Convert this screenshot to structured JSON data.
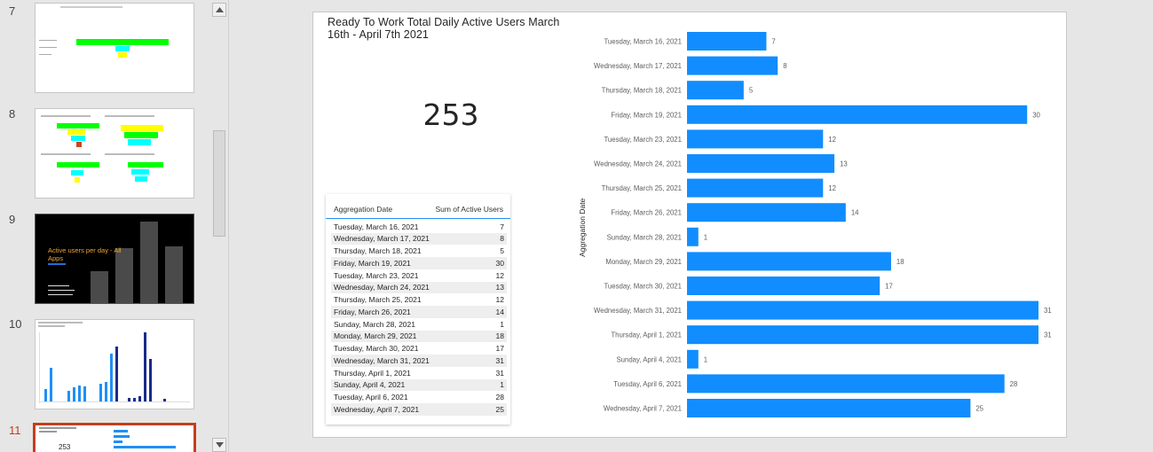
{
  "slides": {
    "numbers": [
      "7",
      "8",
      "9",
      "10",
      "11"
    ],
    "thumb9_text": "Active users per day - All Apps",
    "thumb11_kpi": "253"
  },
  "main": {
    "title": "Ready To Work Total Daily Active Users March 16th - April 7th 2021",
    "kpi_value": "253",
    "table": {
      "col_date": "Aggregation Date",
      "col_sum": "Sum of Active Users",
      "rows": [
        {
          "date": "Tuesday, March 16, 2021",
          "value": "7"
        },
        {
          "date": "Wednesday, March 17, 2021",
          "value": "8"
        },
        {
          "date": "Thursday, March 18, 2021",
          "value": "5"
        },
        {
          "date": "Friday, March 19, 2021",
          "value": "30"
        },
        {
          "date": "Tuesday, March 23, 2021",
          "value": "12"
        },
        {
          "date": "Wednesday, March 24, 2021",
          "value": "13"
        },
        {
          "date": "Thursday, March 25, 2021",
          "value": "12"
        },
        {
          "date": "Friday, March 26, 2021",
          "value": "14"
        },
        {
          "date": "Sunday, March 28, 2021",
          "value": "1"
        },
        {
          "date": "Monday, March 29, 2021",
          "value": "18"
        },
        {
          "date": "Tuesday, March 30, 2021",
          "value": "17"
        },
        {
          "date": "Wednesday, March 31, 2021",
          "value": "31"
        },
        {
          "date": "Thursday, April 1, 2021",
          "value": "31"
        },
        {
          "date": "Sunday, April 4, 2021",
          "value": "1"
        },
        {
          "date": "Tuesday, April 6, 2021",
          "value": "28"
        },
        {
          "date": "Wednesday, April 7, 2021",
          "value": "25"
        }
      ]
    }
  },
  "colors": {
    "bar": "#118dff",
    "selected_slide_border": "#c43e1c",
    "thumb_green": "#00ff00",
    "thumb_cyan": "#00ffff",
    "thumb_yellow": "#ffff00"
  },
  "chart_data": {
    "type": "bar",
    "orientation": "horizontal",
    "ylabel": "Aggregation Date",
    "xlabel": "",
    "categories": [
      "Tuesday, March 16, 2021",
      "Wednesday, March 17, 2021",
      "Thursday, March 18, 2021",
      "Friday, March 19, 2021",
      "Tuesday, March 23, 2021",
      "Wednesday, March 24, 2021",
      "Thursday, March 25, 2021",
      "Friday, March 26, 2021",
      "Sunday, March 28, 2021",
      "Monday, March 29, 2021",
      "Tuesday, March 30, 2021",
      "Wednesday, March 31, 2021",
      "Thursday, April 1, 2021",
      "Sunday, April 4, 2021",
      "Tuesday, April 6, 2021",
      "Wednesday, April 7, 2021"
    ],
    "values": [
      7,
      8,
      5,
      30,
      12,
      13,
      12,
      14,
      1,
      18,
      17,
      31,
      31,
      1,
      28,
      25
    ],
    "xlim": [
      0,
      31
    ],
    "grid": false,
    "data_labels": true
  }
}
